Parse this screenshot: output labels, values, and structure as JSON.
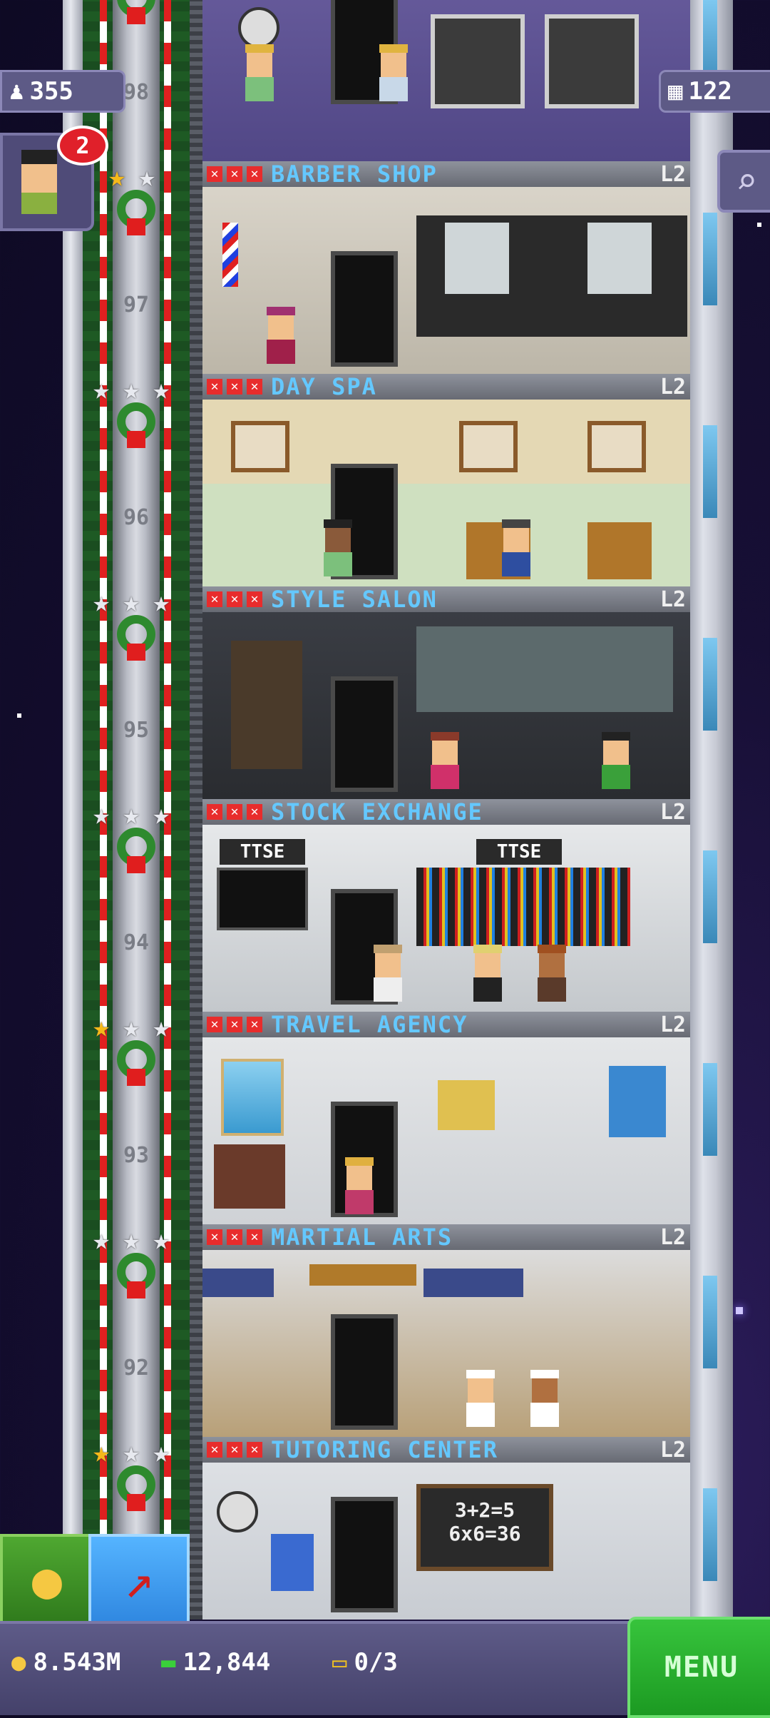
{
  "hud": {
    "population": "355",
    "floor_count": "122",
    "visitor_badge": "2"
  },
  "floors": [
    {
      "name": "BARBER SHOP",
      "level": "L2",
      "number": "97"
    },
    {
      "name": "DAY SPA",
      "level": "L2",
      "number": "96"
    },
    {
      "name": "STYLE SALON",
      "level": "L2",
      "number": "95"
    },
    {
      "name": "STOCK EXCHANGE",
      "level": "L2",
      "number": "94"
    },
    {
      "name": "TRAVEL AGENCY",
      "level": "L2",
      "number": "93"
    },
    {
      "name": "MARTIAL ARTS",
      "level": "L2",
      "number": "92"
    },
    {
      "name": "TUTORING CENTER",
      "level": "L2",
      "number": ""
    }
  ],
  "top_floor_number": "98",
  "room_signs": {
    "stock_exchange_left": "TTSE",
    "stock_exchange_right": "TTSE",
    "blackboard_line1": "3+2=5",
    "blackboard_line2": "6x6=36"
  },
  "bottom_bar": {
    "coins": "8.543M",
    "bux": "12,844",
    "tickets": "0/3",
    "menu_label": "MENU"
  },
  "colors": {
    "floor_label": "#64c8ff",
    "menu_green": "#2cb832",
    "shaft_green": "#1e5a24"
  }
}
